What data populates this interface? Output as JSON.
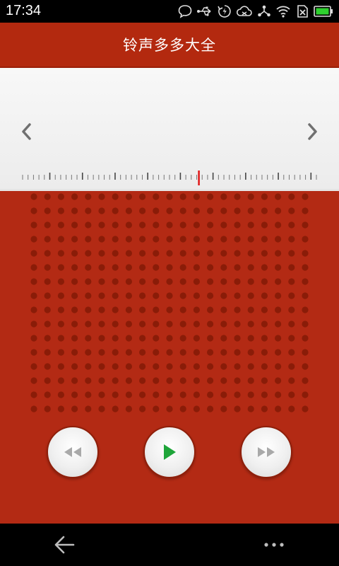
{
  "status_bar": {
    "time": "17:34",
    "icons": [
      "chat-bubble-icon",
      "usb-icon",
      "sync-icon",
      "cloud-icon",
      "share-icon",
      "wifi-icon",
      "sim-x-icon",
      "battery-icon"
    ],
    "battery_color": "#2fd12f"
  },
  "app": {
    "title": "铃声多多大全",
    "colors": {
      "primary": "#b3290f",
      "dot": "#8a1c08",
      "play": "#1fa53a",
      "needle": "#e01010"
    }
  },
  "tuner": {
    "prev_icon": "chevron-left-icon",
    "next_icon": "chevron-right-icon",
    "needle_position": 0.6
  },
  "player": {
    "rewind_icon": "rewind-icon",
    "play_icon": "play-icon",
    "forward_icon": "fast-forward-icon"
  },
  "nav_bar": {
    "back_icon": "back-arrow-icon",
    "menu_icon": "more-dots-icon"
  }
}
